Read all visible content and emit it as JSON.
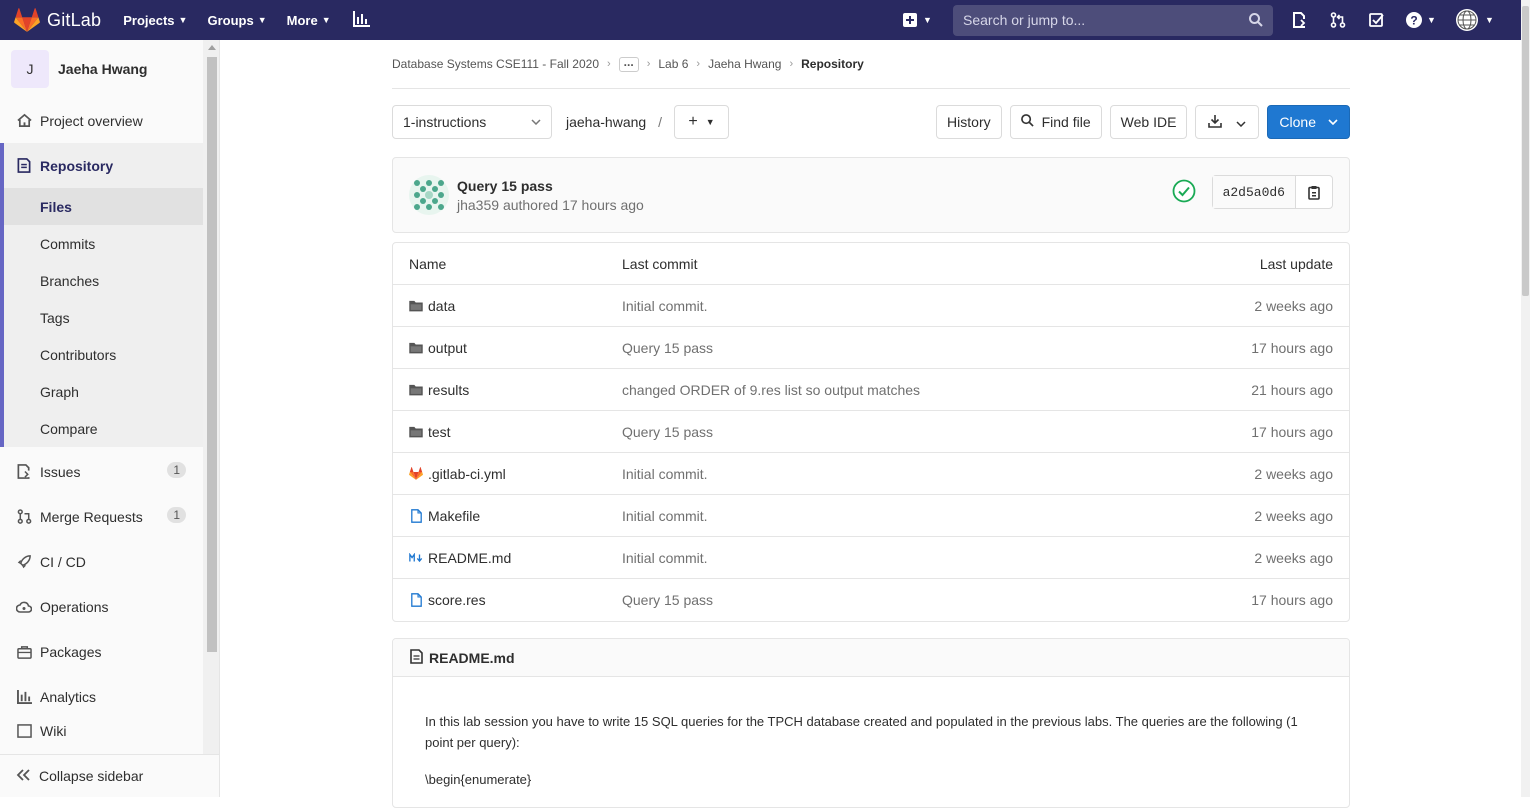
{
  "navbar": {
    "brand": "GitLab",
    "menu": [
      {
        "label": "Projects",
        "has_caret": true
      },
      {
        "label": "Groups",
        "has_caret": true
      },
      {
        "label": "More",
        "has_caret": true
      }
    ],
    "search_placeholder": "Search or jump to...",
    "bg_color": "#292961",
    "icons": [
      "plus-square-icon",
      "search-icon",
      "merge-request-sidebar-icon",
      "merge-request-icon",
      "todo-icon",
      "help-icon",
      "user-avatar-globe"
    ]
  },
  "sidebar": {
    "project_initial": "J",
    "project_name": "Jaeha Hwang",
    "items": [
      {
        "label": "Project overview",
        "icon": "home-icon"
      },
      {
        "label": "Repository",
        "icon": "repository-icon",
        "active": true
      },
      {
        "label": "Issues",
        "icon": "issues-icon",
        "badge": "1"
      },
      {
        "label": "Merge Requests",
        "icon": "merge-request-icon",
        "badge": "1"
      },
      {
        "label": "CI / CD",
        "icon": "rocket-icon"
      },
      {
        "label": "Operations",
        "icon": "cloud-gear-icon"
      },
      {
        "label": "Packages",
        "icon": "package-icon"
      },
      {
        "label": "Analytics",
        "icon": "chart-icon"
      },
      {
        "label": "Wiki",
        "icon": "book-icon"
      }
    ],
    "repository_sub": [
      "Files",
      "Commits",
      "Branches",
      "Tags",
      "Contributors",
      "Graph",
      "Compare"
    ],
    "collapse_label": "Collapse sidebar"
  },
  "breadcrumb": {
    "items": [
      "Database Systems CSE111 - Fall 2020",
      "...",
      "Lab 6",
      "Jaeha Hwang"
    ],
    "current": "Repository"
  },
  "toolbar": {
    "branch": "1-instructions",
    "path": "jaeha-hwang",
    "path_sep": "/",
    "history": "History",
    "find_file": "Find file",
    "web_ide": "Web IDE",
    "clone": "Clone"
  },
  "commit": {
    "title": "Query 15 pass",
    "author": "jha359",
    "meta_suffix": "authored 17 hours ago",
    "sha": "a2d5a0d6",
    "status_color": "#1aaa55"
  },
  "tree": {
    "headers": {
      "name": "Name",
      "commit": "Last commit",
      "date": "Last update"
    },
    "rows": [
      {
        "name": "data",
        "type": "folder",
        "commit": "Initial commit.",
        "date": "2 weeks ago"
      },
      {
        "name": "output",
        "type": "folder",
        "commit": "Query 15 pass",
        "date": "17 hours ago"
      },
      {
        "name": "results",
        "type": "folder",
        "commit": "changed ORDER of 9.res list so output matches",
        "date": "21 hours ago"
      },
      {
        "name": "test",
        "type": "folder",
        "commit": "Query 15 pass",
        "date": "17 hours ago"
      },
      {
        "name": ".gitlab-ci.yml",
        "type": "gitlab",
        "commit": "Initial commit.",
        "date": "2 weeks ago"
      },
      {
        "name": "Makefile",
        "type": "file",
        "commit": "Initial commit.",
        "date": "2 weeks ago"
      },
      {
        "name": "README.md",
        "type": "markdown",
        "commit": "Initial commit.",
        "date": "2 weeks ago"
      },
      {
        "name": "score.res",
        "type": "file",
        "commit": "Query 15 pass",
        "date": "17 hours ago"
      }
    ]
  },
  "readme": {
    "filename": "README.md",
    "paragraph": "In this lab session you have to write 15 SQL queries for the TPCH database created and populated in the previous labs. The queries are the following (1 point per query):",
    "line2": "\\begin{enumerate}"
  }
}
